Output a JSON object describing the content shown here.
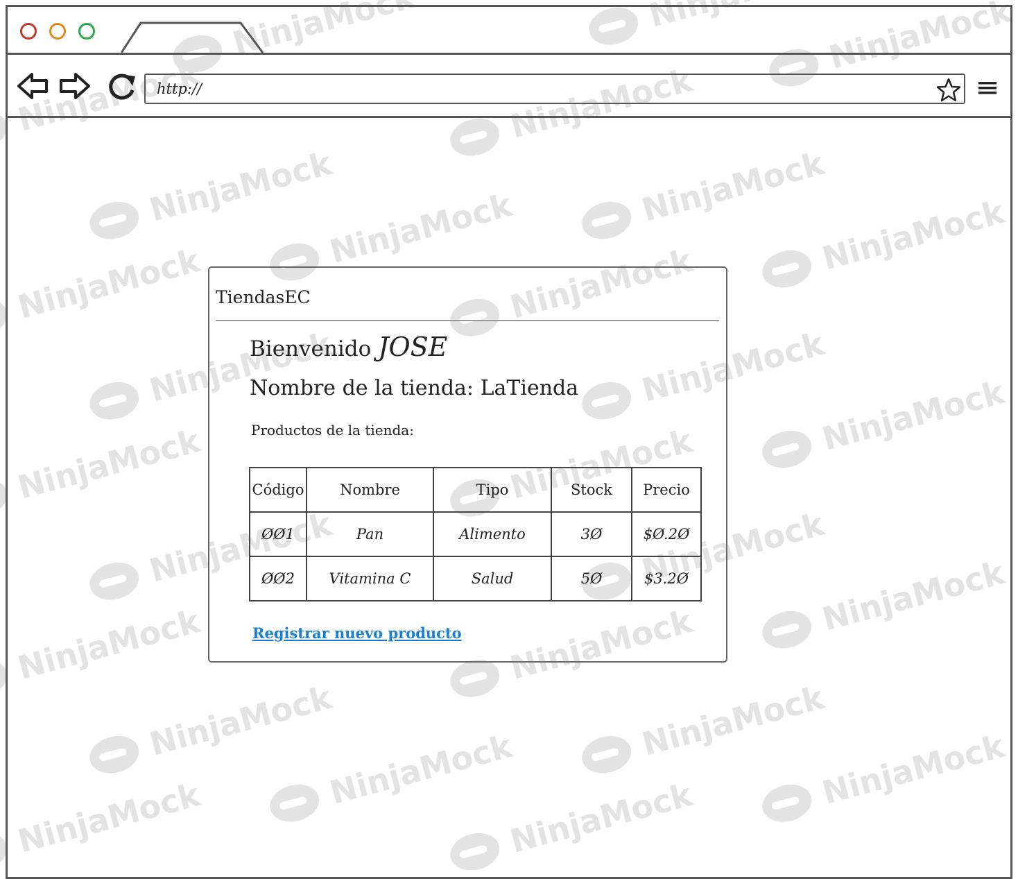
{
  "watermark": {
    "text": "NinjaMock"
  },
  "browser": {
    "address_bar": {
      "value": "http://"
    },
    "icons": {
      "back": "back-arrow-icon",
      "forward": "forward-arrow-icon",
      "reload": "reload-icon",
      "bookmark": "star-icon",
      "menu": "hamburger-menu-icon"
    },
    "traffic_light_colors": {
      "close": "#c0392b",
      "minimize": "#e08a1e",
      "maximize": "#2ea84a"
    }
  },
  "page": {
    "brand": "TiendasEC",
    "welcome_prefix": "Bienvenido",
    "user_name": "JOSE",
    "store_name_line": "Nombre de la tienda: LaTienda",
    "products_label": "Productos de la tienda:",
    "table": {
      "columns": [
        "Código",
        "Nombre",
        "Tipo",
        "Stock",
        "Precio"
      ],
      "rows": [
        [
          "ØØ1",
          "Pan",
          "Alimento",
          "3Ø",
          "$Ø.2Ø"
        ],
        [
          "ØØ2",
          "Vitamina C",
          "Salud",
          "5Ø",
          "$3.2Ø"
        ]
      ]
    },
    "register_link": "Registrar nuevo producto",
    "link_color": "#1a7fd4"
  }
}
